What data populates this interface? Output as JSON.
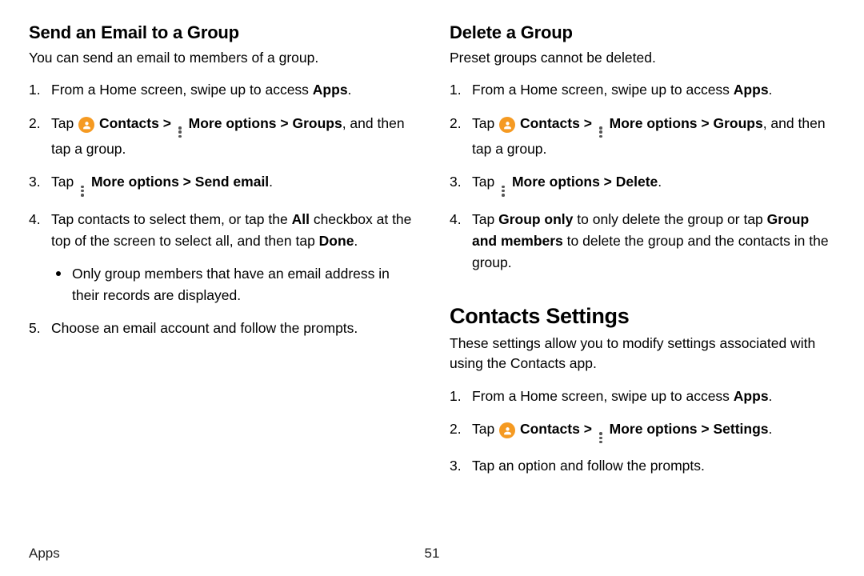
{
  "left": {
    "heading": "Send an Email to a Group",
    "intro": "You can send an email to members of a group.",
    "steps": {
      "s1_a": "From a Home screen, swipe up to access ",
      "s1_b": "Apps",
      "s1_c": ".",
      "s2_a": "Tap ",
      "s2_contacts": "Contacts",
      "s2_b": " > ",
      "s2_more": "More options",
      "s2_c": " > ",
      "s2_groups": "Groups",
      "s2_d": ", and then tap a group.",
      "s3_a": "Tap ",
      "s3_more": "More options",
      "s3_b": " > ",
      "s3_send": "Send email",
      "s3_c": ".",
      "s4_a": "Tap contacts to select them, or tap the ",
      "s4_all": "All",
      "s4_b": " checkbox at the top of the screen to select all, and then tap ",
      "s4_done": "Done",
      "s4_c": ".",
      "s4_bullet": "Only group members that have an email address in their records are displayed.",
      "s5": "Choose an email account and follow the prompts."
    }
  },
  "right": {
    "heading": "Delete a Group",
    "intro": "Preset groups cannot be deleted.",
    "steps": {
      "s1_a": "From a Home screen, swipe up to access ",
      "s1_b": "Apps",
      "s1_c": ".",
      "s2_a": "Tap ",
      "s2_contacts": "Contacts",
      "s2_b": " > ",
      "s2_more": "More options",
      "s2_c": " > ",
      "s2_groups": "Groups",
      "s2_d": ", and then tap a group.",
      "s3_a": "Tap ",
      "s3_more": "More options",
      "s3_b": " > ",
      "s3_del": "Delete",
      "s3_c": ".",
      "s4_a": "Tap ",
      "s4_go": "Group only",
      "s4_b": " to only delete the group or tap ",
      "s4_gm": "Group and members",
      "s4_c": " to delete the group and the contacts in the group."
    },
    "settings_heading": "Contacts Settings",
    "settings_intro": "These settings allow you to modify settings associated with using the Contacts app.",
    "settings_steps": {
      "s1_a": "From a Home screen, swipe up to access ",
      "s1_b": "Apps",
      "s1_c": ".",
      "s2_a": "Tap ",
      "s2_contacts": "Contacts",
      "s2_b": " > ",
      "s2_more": "More options",
      "s2_c": " > ",
      "s2_set": "Settings",
      "s2_d": ".",
      "s3": "Tap an option and follow the prompts."
    }
  },
  "footer": {
    "section": "Apps",
    "page": "51"
  }
}
